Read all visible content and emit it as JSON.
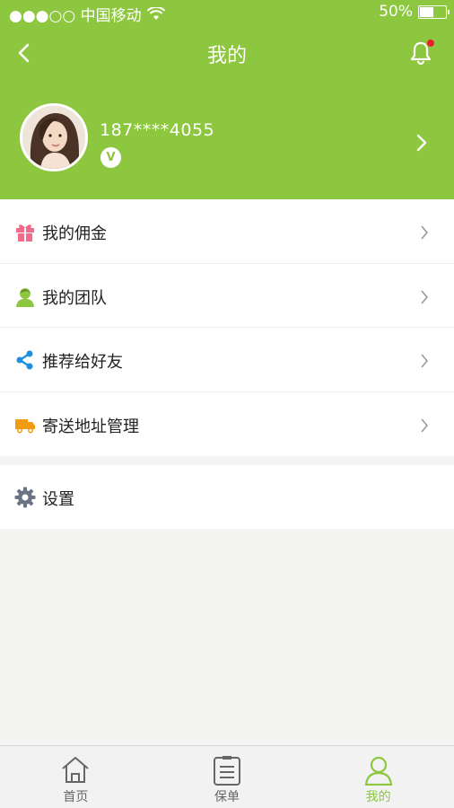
{
  "status_bar": {
    "carrier": "●●●○○ 中国移动",
    "battery_text": "50%",
    "battery_level": 0.5
  },
  "nav": {
    "title": "我的"
  },
  "profile": {
    "phone": "187****4055",
    "vip_label": "V"
  },
  "menu": [
    {
      "label": "我的佣金",
      "icon": "gift-icon",
      "color": "#f06b8a"
    },
    {
      "label": "我的团队",
      "icon": "team-icon",
      "color": "#8dc63f"
    },
    {
      "label": "推荐给好友",
      "icon": "share-icon",
      "color": "#1e8fe1"
    },
    {
      "label": "寄送地址管理",
      "icon": "truck-icon",
      "color": "#f29b12"
    }
  ],
  "settings": {
    "label": "设置",
    "icon": "gear-icon",
    "color": "#6b7486"
  },
  "tabs": [
    {
      "label": "首页",
      "icon": "home-icon",
      "active": false
    },
    {
      "label": "保单",
      "icon": "document-icon",
      "active": false
    },
    {
      "label": "我的",
      "icon": "user-icon",
      "active": true
    }
  ],
  "colors": {
    "accent": "#8dc63f",
    "notification_dot": "#e8222b"
  }
}
